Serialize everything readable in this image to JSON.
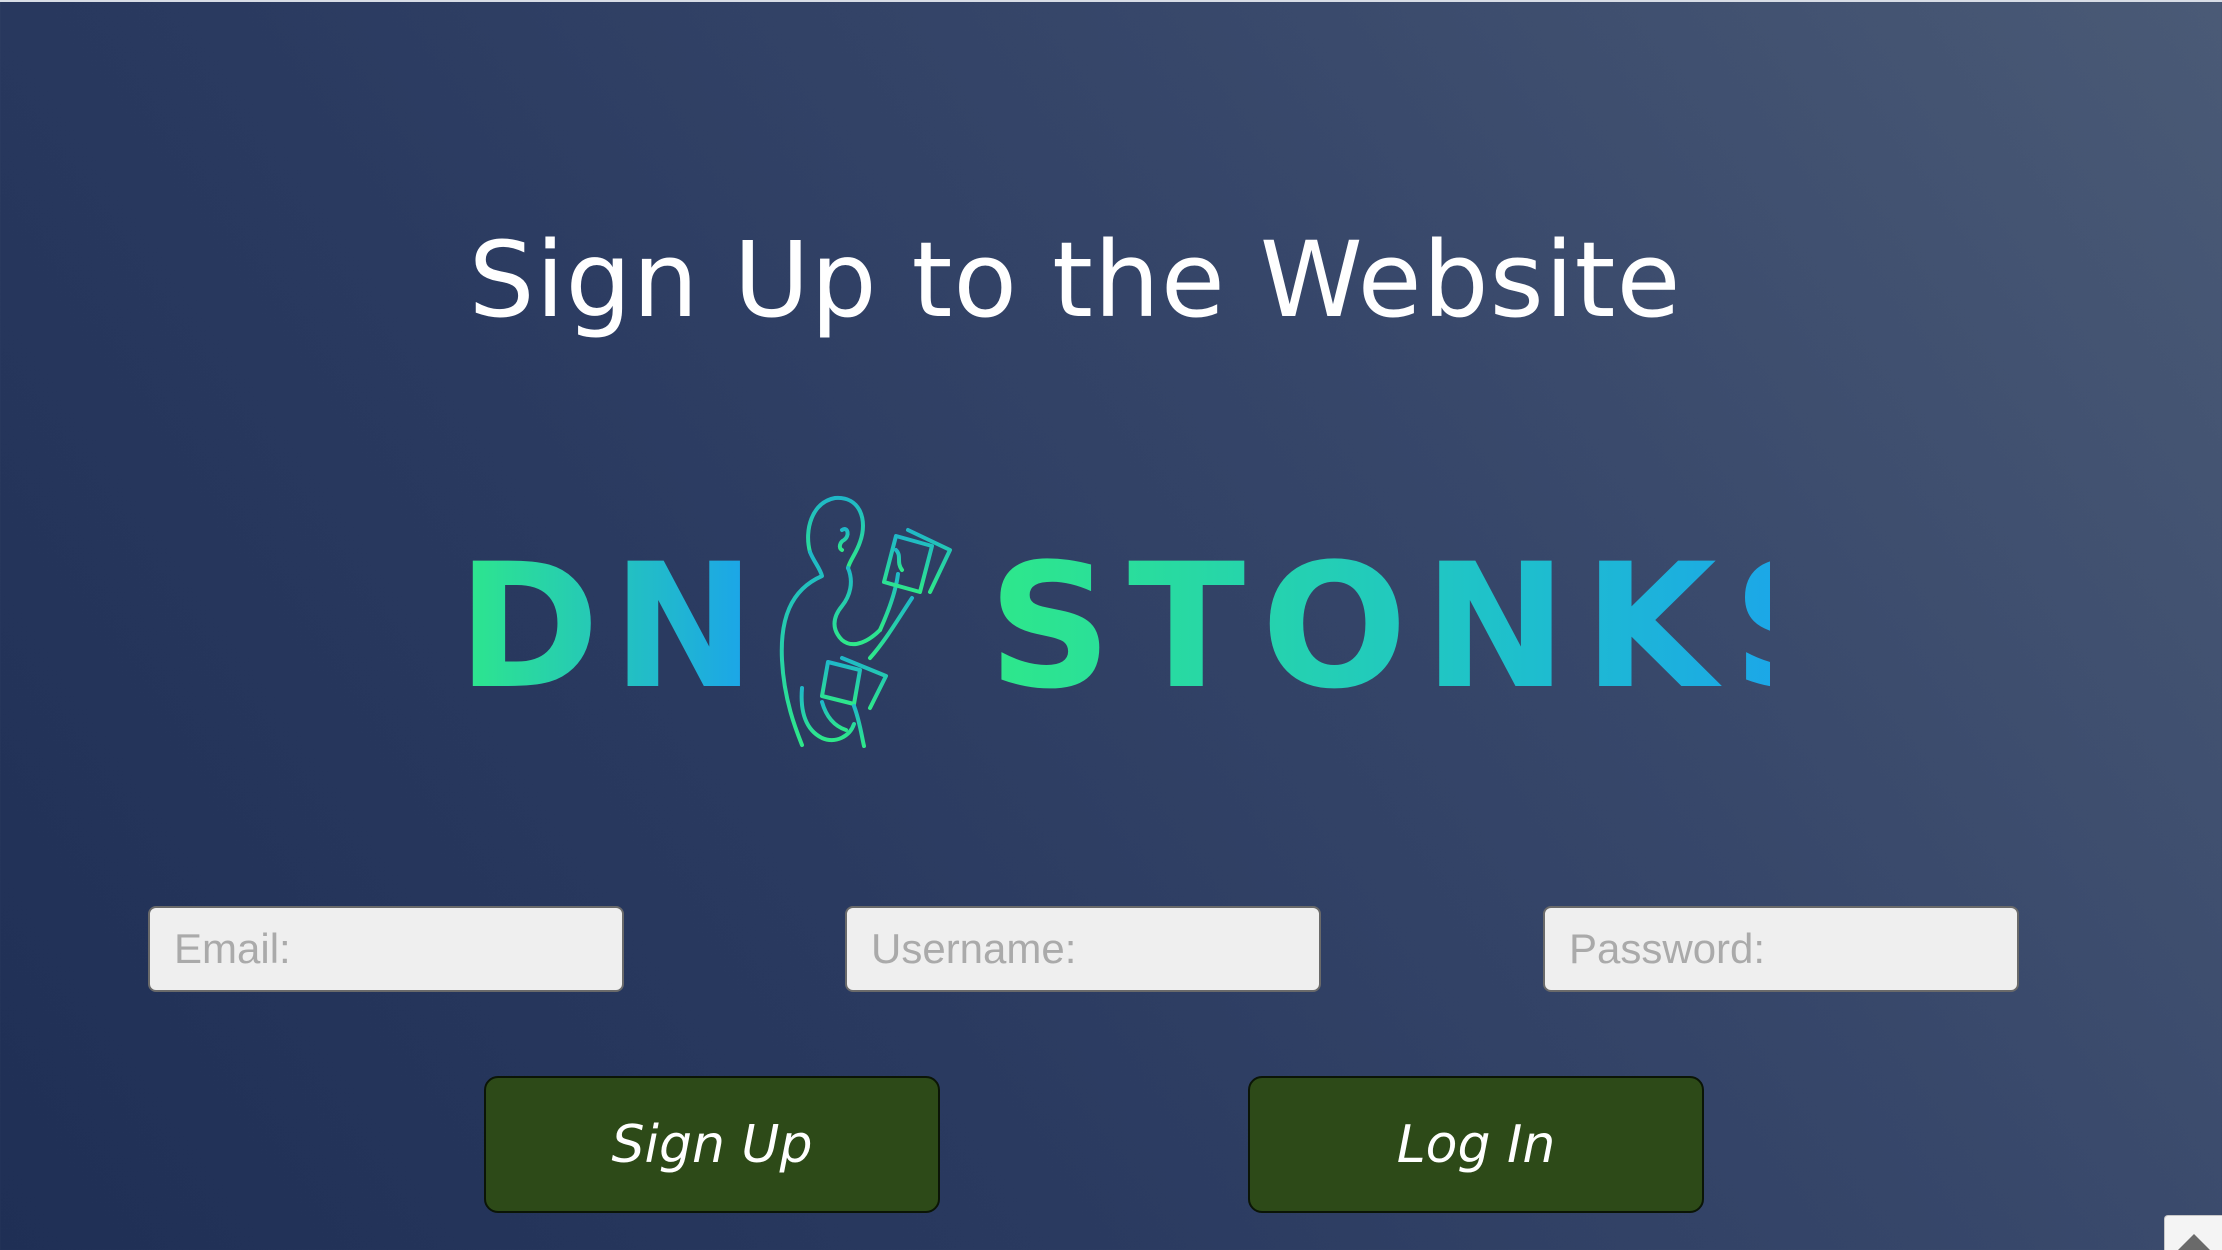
{
  "page": {
    "title": "Sign Up to the Website"
  },
  "logo": {
    "text_left": "DN",
    "text_right": "STONKS",
    "gradient_start": "#2ee88a",
    "gradient_end": "#1aa0f0",
    "figure_icon": "person-holding-cards-icon"
  },
  "form": {
    "email_placeholder": "Email:",
    "username_placeholder": "Username:",
    "password_placeholder": "Password:"
  },
  "buttons": {
    "signup_label": "Sign Up",
    "login_label": "Log In",
    "color": "#2d4a18"
  },
  "colors": {
    "background_dark": "#1f2f55",
    "background_light": "#4a5a76",
    "title": "#ffffff"
  }
}
